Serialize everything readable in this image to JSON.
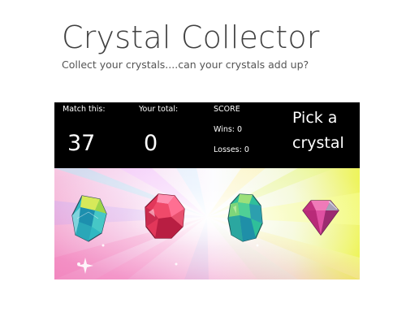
{
  "header": {
    "title": "Crystal Collector",
    "subtitle": "Collect your crystals....can your crystals add up?"
  },
  "scoreboard": {
    "match_label": "Match this:",
    "match_value": "37",
    "total_label": "Your total:",
    "total_value": "0",
    "score_label": "SCORE",
    "wins_text": "Wins: 0",
    "losses_text": "Losses: 0",
    "prompt_line1": "Pick a",
    "prompt_line2": "crystal"
  },
  "crystals": [
    {
      "name": "crystal-teal-yellow",
      "icon": "teal-gem-icon"
    },
    {
      "name": "crystal-red",
      "icon": "red-gem-icon"
    },
    {
      "name": "crystal-green-teal",
      "icon": "green-gem-icon"
    },
    {
      "name": "crystal-pink-diamond",
      "icon": "pink-diamond-icon"
    }
  ],
  "colors": {
    "scoreboard_bg": "#000000",
    "scoreboard_text": "#ffffff",
    "title": "#404040"
  }
}
